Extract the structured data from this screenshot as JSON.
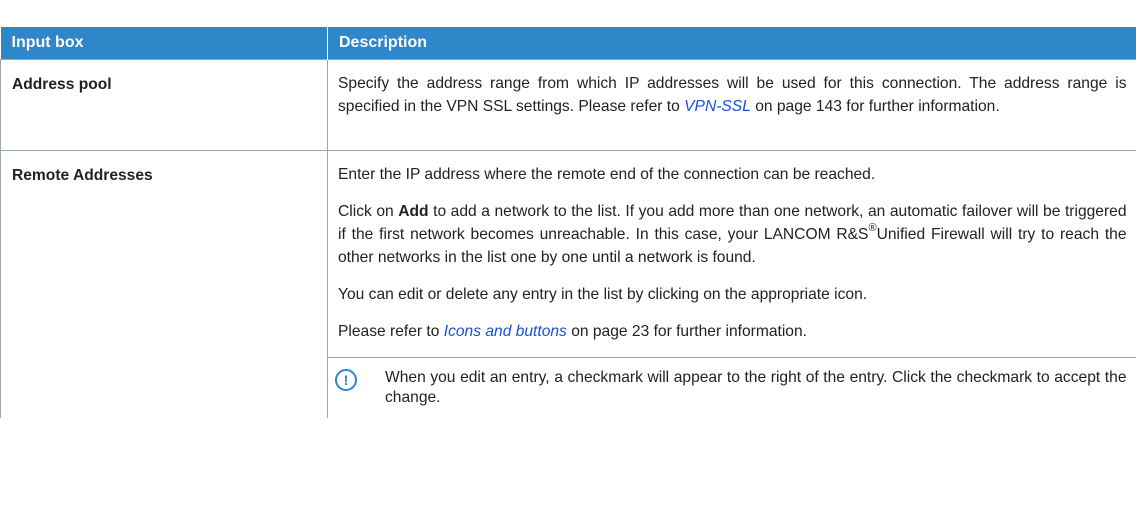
{
  "table": {
    "headers": [
      "Input box",
      "Description"
    ],
    "rows": [
      {
        "label": "Address pool",
        "p1_before": "Specify the address range from which IP addresses will be used for this connection. The address range is specified in the VPN SSL settings. Please refer to ",
        "p1_link": "VPN-SSL",
        "p1_after": " on page 143 for further information."
      },
      {
        "label": "Remote Addresses",
        "p1": "Enter the IP address where the remote end of the connection can be reached.",
        "p2_before": "Click on ",
        "p2_bold": "Add",
        "p2_mid": " to add a network to the list. If you add more than one network, an automatic failover will be triggered if the first network becomes unreachable. In this case, your LANCOM R&S",
        "p2_reg": "®",
        "p2_after": "Unified Firewall will try to reach the other networks in the list one by one until a network is found.",
        "p3": "You can edit or delete any entry in the list by clicking on the appropriate icon.",
        "p4_before": "Please refer to ",
        "p4_link": "Icons and buttons",
        "p4_after": " on page 23 for further information.",
        "note_icon": "info-exclamation-icon",
        "note_glyph": "!",
        "note": "When you edit an entry, a checkmark will appear to the right of the entry. Click the checkmark to accept the change."
      }
    ]
  },
  "colors": {
    "header_bg": "#2f86c8",
    "link": "#1a4fd6",
    "rule": "#9aa7b1"
  }
}
